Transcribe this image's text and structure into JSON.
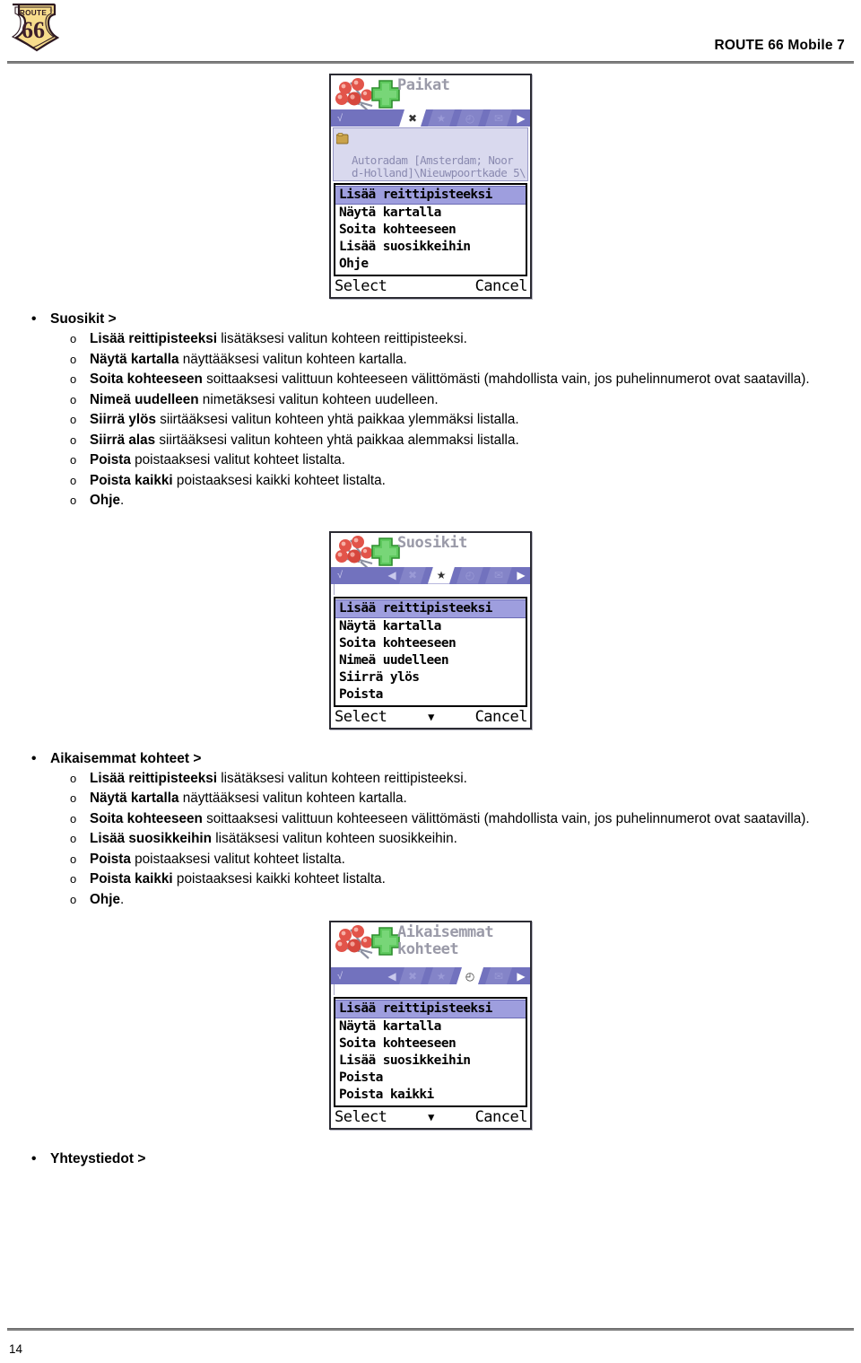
{
  "header": {
    "title": "ROUTE 66 Mobile 7",
    "logo_alt": "ROUTE 66",
    "logo_top_text": "ROUTE",
    "logo_number": "66"
  },
  "footer": {
    "page_number": "14"
  },
  "shots": [
    {
      "id": "paikat",
      "title": "Paikat",
      "tabs": [
        {
          "icon": "close-x-icon",
          "glyph": "✖",
          "active": true
        },
        {
          "icon": "star-icon",
          "glyph": "★",
          "active": false
        },
        {
          "icon": "clock-icon",
          "glyph": "◴",
          "active": false
        },
        {
          "icon": "envelope-icon",
          "glyph": "✉",
          "active": false
        }
      ],
      "has_left_arrow": false,
      "address": "Autoradam [Amsterdam; Noor\nd-Holland]\\Nieuwpoortkade 5\\",
      "menu": [
        {
          "label": "Lisää reittipisteeksi",
          "selected": true
        },
        {
          "label": "Näytä kartalla",
          "selected": false
        },
        {
          "label": "Soita kohteeseen",
          "selected": false
        },
        {
          "label": "Lisää suosikkeihin",
          "selected": false
        },
        {
          "label": "Ohje",
          "selected": false
        }
      ],
      "softkey_left": "Select",
      "softkey_right": "Cancel",
      "scroll_indicator": ""
    },
    {
      "id": "suosikit",
      "title": "Suosikit",
      "tabs": [
        {
          "icon": "close-x-icon",
          "glyph": "✖",
          "active": false
        },
        {
          "icon": "star-icon",
          "glyph": "★",
          "active": true
        },
        {
          "icon": "clock-icon",
          "glyph": "◴",
          "active": false
        },
        {
          "icon": "envelope-icon",
          "glyph": "✉",
          "active": false
        }
      ],
      "has_left_arrow": true,
      "address": "",
      "menu": [
        {
          "label": "Lisää reittipisteeksi",
          "selected": true
        },
        {
          "label": "Näytä kartalla",
          "selected": false
        },
        {
          "label": "Soita kohteeseen",
          "selected": false
        },
        {
          "label": "Nimeä uudelleen",
          "selected": false
        },
        {
          "label": "Siirrä ylös",
          "selected": false
        },
        {
          "label": "Poista",
          "selected": false
        }
      ],
      "softkey_left": "Select",
      "softkey_right": "Cancel",
      "scroll_indicator": "▼"
    },
    {
      "id": "aikaisemmat-kohteet",
      "title": "Aikaisemmat\nkohteet",
      "tabs": [
        {
          "icon": "close-x-icon",
          "glyph": "✖",
          "active": false
        },
        {
          "icon": "star-icon",
          "glyph": "★",
          "active": false
        },
        {
          "icon": "clock-icon",
          "glyph": "◴",
          "active": true
        },
        {
          "icon": "envelope-icon",
          "glyph": "✉",
          "active": false
        }
      ],
      "has_left_arrow": true,
      "address": "",
      "menu": [
        {
          "label": "Lisää reittipisteeksi",
          "selected": true
        },
        {
          "label": "Näytä kartalla",
          "selected": false
        },
        {
          "label": "Soita kohteeseen",
          "selected": false
        },
        {
          "label": "Lisää suosikkeihin",
          "selected": false
        },
        {
          "label": "Poista",
          "selected": false
        },
        {
          "label": "Poista kaikki",
          "selected": false
        }
      ],
      "softkey_left": "Select",
      "softkey_right": "Cancel",
      "scroll_indicator": "▼"
    }
  ],
  "sections": [
    {
      "id": "suosikit-section",
      "heading": "Suosikit >",
      "items": [
        {
          "bold": "Lisää reittipisteeksi",
          "rest": " lisätäksesi valitun kohteen reittipisteeksi."
        },
        {
          "bold": "Näytä kartalla",
          "rest": " näyttääksesi valitun kohteen kartalla."
        },
        {
          "bold": "Soita kohteeseen",
          "rest": " soittaaksesi valittuun kohteeseen välittömästi (mahdollista vain, jos puhelinnumerot ovat saatavilla)."
        },
        {
          "bold": "Nimeä uudelleen",
          "rest": " nimetäksesi valitun kohteen uudelleen."
        },
        {
          "bold": "Siirrä ylös",
          "rest": " siirtääksesi valitun kohteen yhtä paikkaa ylemmäksi listalla."
        },
        {
          "bold": "Siirrä alas",
          "rest": " siirtääksesi valitun kohteen yhtä paikkaa alemmaksi listalla."
        },
        {
          "bold": "Poista",
          "rest": " poistaaksesi valitut kohteet listalta."
        },
        {
          "bold": "Poista kaikki",
          "rest": " poistaaksesi kaikki kohteet listalta."
        },
        {
          "bold": "Ohje",
          "rest": "."
        }
      ]
    },
    {
      "id": "aikaisemmat-kohteet-section",
      "heading": "Aikaisemmat kohteet >",
      "items": [
        {
          "bold": "Lisää reittipisteeksi",
          "rest": " lisätäksesi valitun kohteen reittipisteeksi."
        },
        {
          "bold": "Näytä kartalla",
          "rest": " näyttääksesi valitun kohteen kartalla."
        },
        {
          "bold": "Soita kohteeseen",
          "rest": " soittaaksesi valittuun kohteeseen välittömästi (mahdollista vain, jos puhelinnumerot ovat saatavilla)."
        },
        {
          "bold": "Lisää suosikkeihin",
          "rest": " lisätäksesi valitun kohteen suosikkeihin."
        },
        {
          "bold": "Poista",
          "rest": " poistaaksesi valitut kohteet listalta."
        },
        {
          "bold": "Poista kaikki",
          "rest": " poistaaksesi kaikki kohteet listalta."
        },
        {
          "bold": "Ohje",
          "rest": "."
        }
      ]
    },
    {
      "id": "yhteystiedot-section",
      "heading": "Yhteystiedot >",
      "items": []
    }
  ],
  "bullets": {
    "level1": "•",
    "level2": "o"
  },
  "colors": {
    "tabbar": "#7272be",
    "menu_highlight": "#9e9ede",
    "title_gray": "#9a9aa8",
    "address_bg": "#d9d9ee",
    "rule_gray": "#808080",
    "logo_yellow": "#f5d97a",
    "logo_dark": "#3d1f2b"
  }
}
